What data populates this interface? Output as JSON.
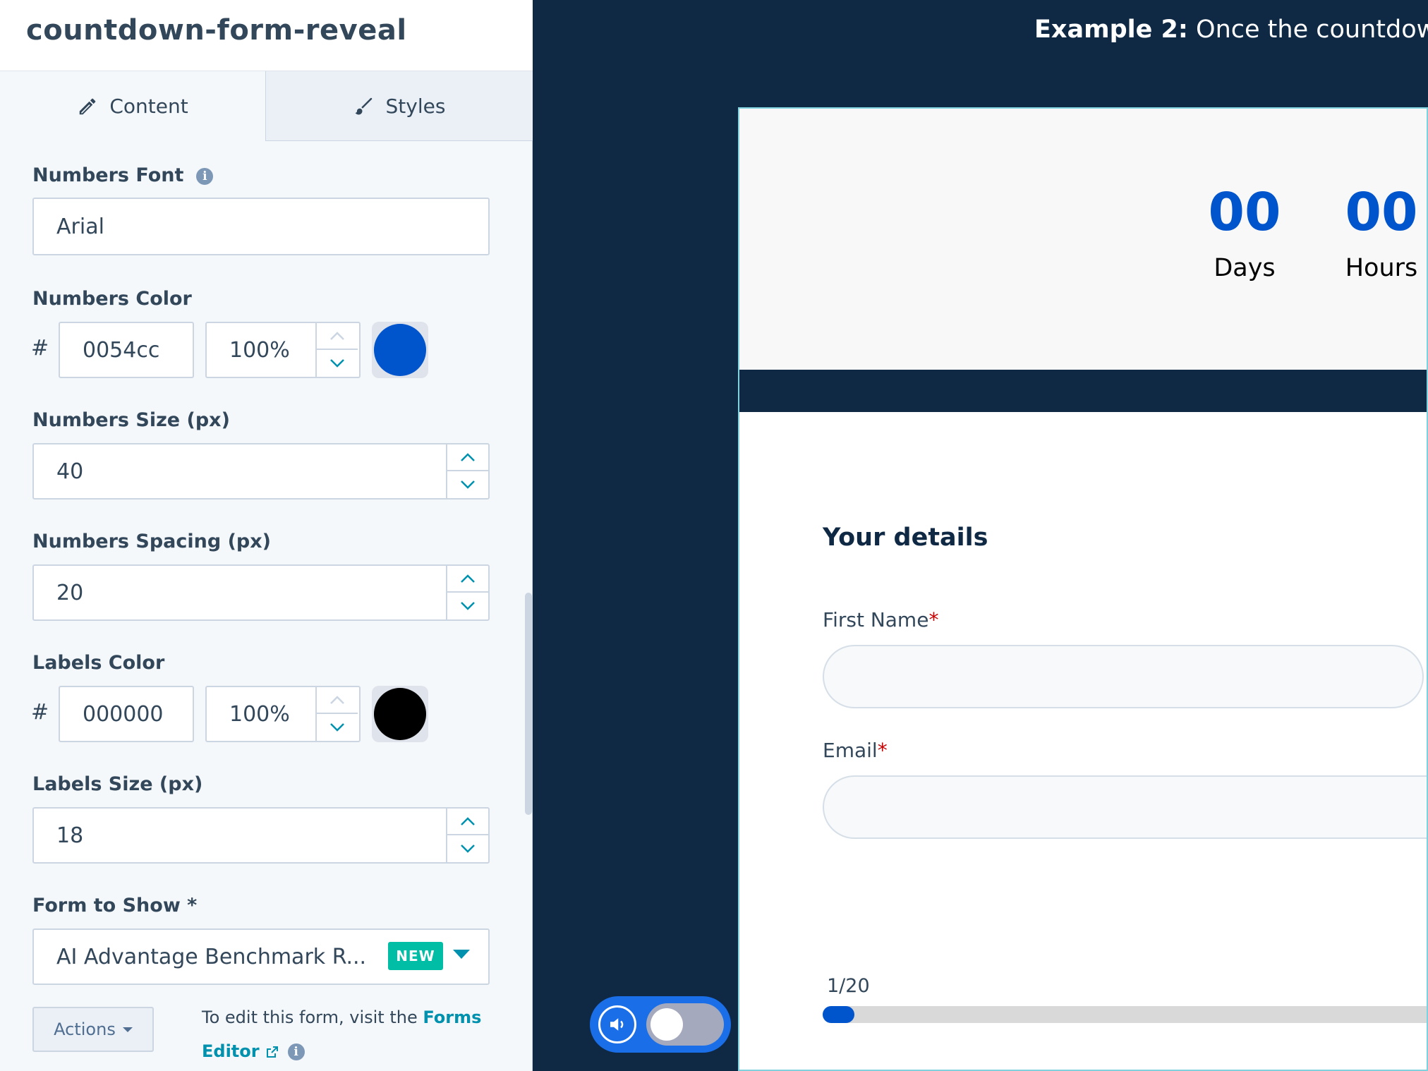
{
  "module": {
    "title": "countdown-form-reveal"
  },
  "tabs": [
    {
      "label": "Content",
      "icon": "pencil-icon",
      "active": true
    },
    {
      "label": "Styles",
      "icon": "brush-icon",
      "active": false
    }
  ],
  "fields": {
    "numbers_font": {
      "label": "Numbers Font",
      "value": "Arial"
    },
    "numbers_color": {
      "label": "Numbers Color",
      "hash": "#",
      "hex": "0054cc",
      "opacity": "100%",
      "swatch": "#0054cc"
    },
    "numbers_size": {
      "label": "Numbers Size (px)",
      "value": "40"
    },
    "numbers_spacing": {
      "label": "Numbers Spacing (px)",
      "value": "20"
    },
    "labels_color": {
      "label": "Labels Color",
      "hash": "#",
      "hex": "000000",
      "opacity": "100%",
      "swatch": "#000000"
    },
    "labels_size": {
      "label": "Labels Size (px)",
      "value": "18"
    },
    "form_to_show": {
      "label": "Form to Show *",
      "value": "AI Advantage Benchmark R...",
      "badge": "NEW"
    }
  },
  "actions": {
    "button_label": "Actions",
    "note_prefix": "To edit this form, visit the ",
    "link_label_1": "Forms",
    "link_label_2": "Editor"
  },
  "preview": {
    "heading_bold": "Example 2:",
    "heading_text": " Once the countdown",
    "countdown": [
      {
        "number": "00",
        "label": "Days"
      },
      {
        "number": "00",
        "label": "Hours"
      }
    ],
    "form": {
      "heading": "Your details",
      "first_name_label": "First Name",
      "email_label": "Email",
      "required_mark": "*",
      "progress_text": "1/20",
      "progress_fraction": 0.05
    }
  },
  "colors": {
    "accent": "#0054cc",
    "link": "#0091ae",
    "badge": "#00bda5",
    "dark_navy": "#0f2944"
  }
}
